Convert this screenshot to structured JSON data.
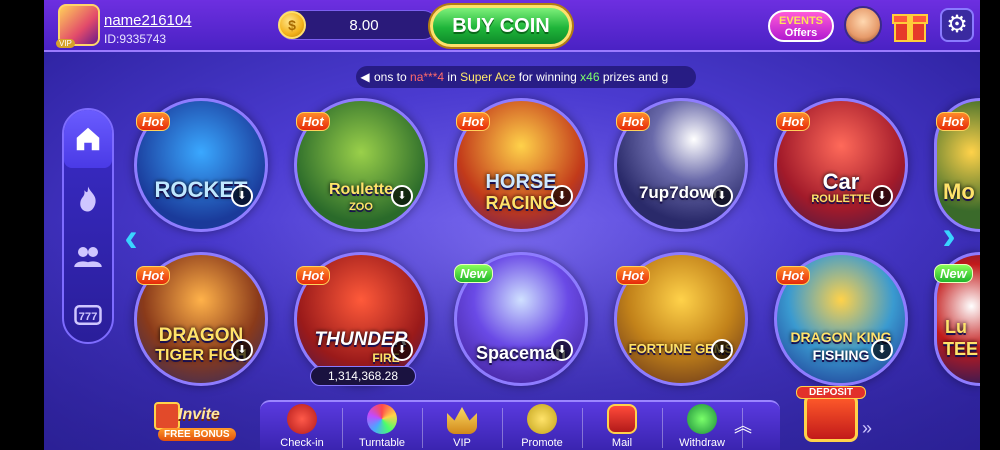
{
  "header": {
    "username": "name216104",
    "user_id": "ID:9335743",
    "vip_label": "VIP",
    "coin_balance": "8.00",
    "buy_coin_label": "BUY COIN",
    "events_line1": "EVENTS",
    "events_line2": "Offers"
  },
  "ticker": {
    "part1": "ons to ",
    "user": "na***4",
    "part2": " in ",
    "game": "Super Ace",
    "part3": " for winning ",
    "mult": "x46",
    "part4": " prizes and g"
  },
  "games": [
    {
      "name": "ROCKET",
      "badge": "Hot"
    },
    {
      "name": "Roulette",
      "sub": "ZOO",
      "badge": "Hot"
    },
    {
      "name": "HORSE",
      "sub": "RACING",
      "badge": "Hot"
    },
    {
      "name": "7up7down",
      "badge": "Hot"
    },
    {
      "name": "Car",
      "sub": "ROULETTE",
      "badge": "Hot"
    },
    {
      "name": "Mo",
      "badge": "Hot"
    },
    {
      "name": "DRAGON",
      "sub": "TIGER FIGH",
      "badge": "Hot"
    },
    {
      "name": "THUNDER",
      "sub": "FIRE",
      "badge": "Hot",
      "jackpot": "1,314,368.28"
    },
    {
      "name": "Spaceman",
      "badge": "New"
    },
    {
      "name": "FORTUNE GEMS",
      "badge": "Hot"
    },
    {
      "name": "DRAGON KING",
      "sub": "FISHING",
      "badge": "Hot"
    },
    {
      "name": "Lu",
      "sub": "TEE",
      "badge": "New"
    }
  ],
  "bottom_nav": [
    {
      "label": "Check-in"
    },
    {
      "label": "Turntable"
    },
    {
      "label": "VIP"
    },
    {
      "label": "Promote"
    },
    {
      "label": "Mail"
    },
    {
      "label": "Withdraw"
    }
  ],
  "invite": {
    "label": "Invite",
    "sub": "FREE BONUS"
  },
  "deposit": {
    "label": "DEPOSIT"
  },
  "colors": {
    "accent": "#4a22c4",
    "buy": "#1fb53a",
    "hot": "#e62a0a",
    "new": "#1fb52a"
  }
}
